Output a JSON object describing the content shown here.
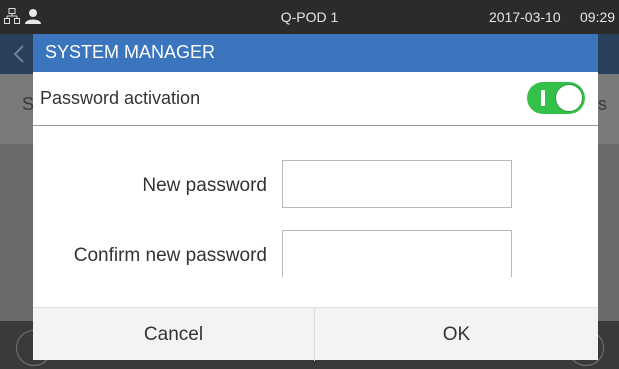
{
  "status_bar": {
    "device_name": "Q-POD 1",
    "date": "2017-03-10",
    "time": "09:29",
    "icons": [
      "network-icon",
      "user-icon"
    ]
  },
  "background": {
    "left_letter": "S",
    "right_letter": "s"
  },
  "dialog": {
    "title": "SYSTEM MANAGER",
    "password_activation": {
      "label": "Password activation",
      "enabled": true,
      "toggle_mark": "I"
    },
    "fields": {
      "new_password": {
        "label": "New password",
        "value": ""
      },
      "confirm_password": {
        "label": "Confirm new password",
        "value": ""
      }
    },
    "buttons": {
      "cancel": "Cancel",
      "ok": "OK"
    }
  },
  "colors": {
    "status_bar": "#2b2b2b",
    "dialog_header": "#3a75bd",
    "toggle_on": "#35c04a",
    "overlay": "#6a6a6a"
  }
}
